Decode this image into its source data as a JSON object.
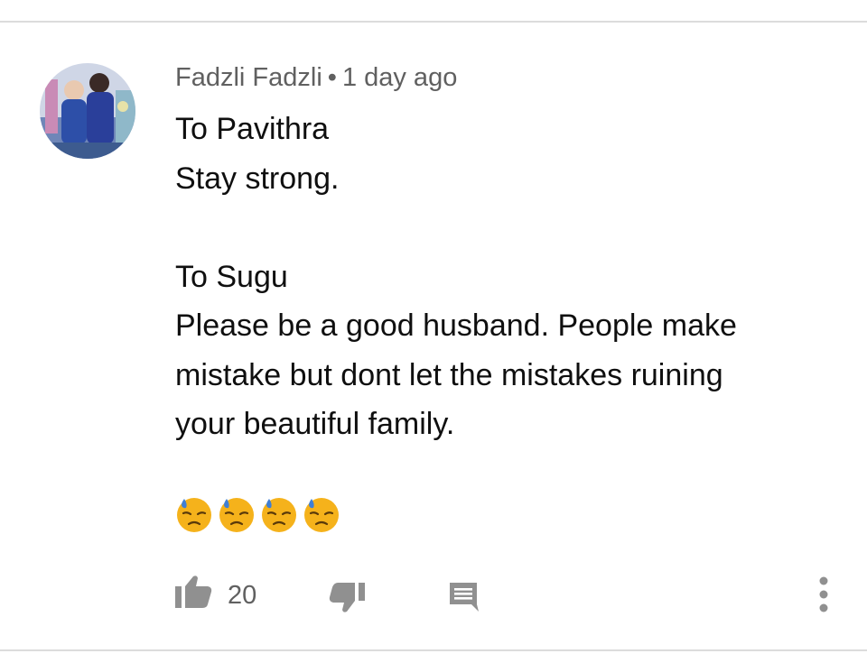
{
  "comment": {
    "author": "Fadzli Fadzli",
    "separator": "•",
    "timestamp": "1 day ago",
    "lines": [
      "To Pavithra",
      "Stay strong.",
      "",
      "To Sugu",
      "Please be a good husband. People make",
      "mistake but dont let the mistakes ruining",
      "your beautiful family."
    ],
    "emojis": [
      "downcast-face-with-sweat",
      "downcast-face-with-sweat",
      "downcast-face-with-sweat",
      "downcast-face-with-sweat"
    ],
    "like_count": "20"
  },
  "icons": {
    "like": "thumbs-up-icon",
    "dislike": "thumbs-down-icon",
    "reply": "comment-icon",
    "more": "more-vertical-icon"
  },
  "colors": {
    "text_primary": "#0f0f0f",
    "text_secondary": "#606060",
    "icon_gray": "#909090",
    "divider": "#dcdcdc",
    "emoji_face": "#f5b21b",
    "emoji_sweat": "#3f7fd6"
  }
}
